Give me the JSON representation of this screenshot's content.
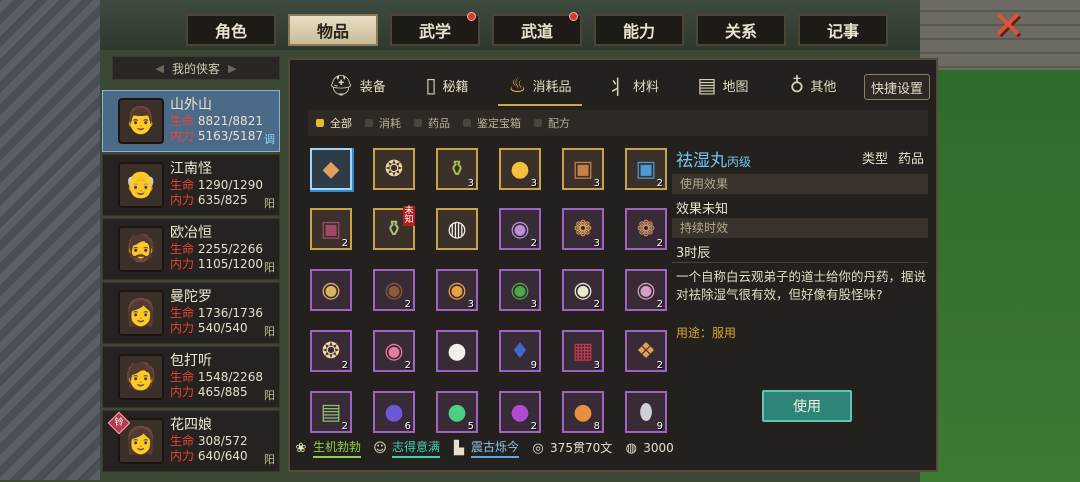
{
  "top_tabs": [
    {
      "label": "角色",
      "active": false,
      "dot": false
    },
    {
      "label": "物品",
      "active": true,
      "dot": false
    },
    {
      "label": "武学",
      "active": false,
      "dot": true
    },
    {
      "label": "武道",
      "active": false,
      "dot": true
    },
    {
      "label": "能力",
      "active": false,
      "dot": false
    },
    {
      "label": "关系",
      "active": false,
      "dot": false
    },
    {
      "label": "记事",
      "active": false,
      "dot": false
    }
  ],
  "close_glyph": "✕",
  "party": {
    "header": "我的侠客",
    "members": [
      {
        "name": "山外山",
        "hp_label": "生命",
        "hp": "8821/8821",
        "mp_label": "内力",
        "mp": "5163/5187",
        "tag": "调",
        "active": true,
        "icon": "👨"
      },
      {
        "name": "江南怪",
        "hp_label": "生命",
        "hp": "1290/1290",
        "mp_label": "内力",
        "mp": "635/825",
        "tag": "阳",
        "active": false,
        "icon": "👴"
      },
      {
        "name": "欧冶恒",
        "hp_label": "生命",
        "hp": "2255/2266",
        "mp_label": "内力",
        "mp": "1105/1200",
        "tag": "阳",
        "active": false,
        "icon": "🧔"
      },
      {
        "name": "曼陀罗",
        "hp_label": "生命",
        "hp": "1736/1736",
        "mp_label": "内力",
        "mp": "540/540",
        "tag": "阳",
        "active": false,
        "icon": "👩"
      },
      {
        "name": "包打听",
        "hp_label": "生命",
        "hp": "1548/2268",
        "mp_label": "内力",
        "mp": "465/885",
        "tag": "阳",
        "active": false,
        "icon": "🧑"
      },
      {
        "name": "花四娘",
        "hp_label": "生命",
        "hp": "308/572",
        "mp_label": "内力",
        "mp": "640/640",
        "tag": "阳",
        "active": false,
        "icon": "👩",
        "badge": "铃"
      }
    ]
  },
  "categories": [
    {
      "label": "装备",
      "icon": "⛑",
      "active": false
    },
    {
      "label": "秘籍",
      "icon": "▯",
      "active": false
    },
    {
      "label": "消耗品",
      "icon": "♨",
      "active": true
    },
    {
      "label": "材料",
      "icon": "⺦",
      "active": false
    },
    {
      "label": "地图",
      "icon": "▤",
      "active": false
    },
    {
      "label": "其他",
      "icon": "♁",
      "active": false
    }
  ],
  "quick_settings": "快捷设置",
  "filters": [
    {
      "label": "全部",
      "active": true
    },
    {
      "label": "消耗",
      "active": false
    },
    {
      "label": "药品",
      "active": false
    },
    {
      "label": "鉴定宝箱",
      "active": false
    },
    {
      "label": "配方",
      "active": false
    }
  ],
  "items": [
    {
      "glyph": "◆",
      "color": "#e0a060",
      "count": "",
      "rarity": "selected"
    },
    {
      "glyph": "❂",
      "color": "#f0d7a8",
      "count": "",
      "rarity": "gold"
    },
    {
      "glyph": "⚱",
      "color": "#9ec04a",
      "count": "3",
      "rarity": "gold"
    },
    {
      "glyph": "●",
      "color": "#f1c23a",
      "count": "3",
      "rarity": "gold"
    },
    {
      "glyph": "▣",
      "color": "#c8804a",
      "count": "3",
      "rarity": "gold"
    },
    {
      "glyph": "▣",
      "color": "#4a9ad8",
      "count": "2",
      "rarity": "gold"
    },
    {
      "glyph": "▣",
      "color": "#a04a6a",
      "count": "2",
      "rarity": "gold"
    },
    {
      "glyph": "⚱",
      "color": "#a9c07a",
      "count": "",
      "rarity": "gold",
      "newtag": "未知"
    },
    {
      "glyph": "◍",
      "color": "#f0ece0",
      "count": "",
      "rarity": "gold"
    },
    {
      "glyph": "◉",
      "color": "#b98fd6",
      "count": "2",
      "rarity": "purple"
    },
    {
      "glyph": "❁",
      "color": "#f2b45a",
      "count": "3",
      "rarity": "purple"
    },
    {
      "glyph": "❁",
      "color": "#e2a070",
      "count": "2",
      "rarity": "purple"
    },
    {
      "glyph": "◉",
      "color": "#d9b560",
      "count": "",
      "rarity": "purple"
    },
    {
      "glyph": "◉",
      "color": "#8a5a3a",
      "count": "2",
      "rarity": "purple"
    },
    {
      "glyph": "◉",
      "color": "#e8a040",
      "count": "3",
      "rarity": "purple"
    },
    {
      "glyph": "◉",
      "color": "#4aa84a",
      "count": "3",
      "rarity": "purple"
    },
    {
      "glyph": "◉",
      "color": "#e8e8d0",
      "count": "2",
      "rarity": "purple"
    },
    {
      "glyph": "◉",
      "color": "#d4a0c8",
      "count": "2",
      "rarity": "purple"
    },
    {
      "glyph": "❂",
      "color": "#f0d7a8",
      "count": "2",
      "rarity": "purple"
    },
    {
      "glyph": "◉",
      "color": "#e87aa0",
      "count": "2",
      "rarity": "purple"
    },
    {
      "glyph": "●",
      "color": "#f2f0e6",
      "count": "",
      "rarity": "purple"
    },
    {
      "glyph": "♦",
      "color": "#3a6ad0",
      "count": "9",
      "rarity": "purple"
    },
    {
      "glyph": "▦",
      "color": "#c23a4a",
      "count": "3",
      "rarity": "purple"
    },
    {
      "glyph": "❖",
      "color": "#e0a050",
      "count": "2",
      "rarity": "purple"
    },
    {
      "glyph": "▤",
      "color": "#8ac070",
      "count": "2",
      "rarity": "purple"
    },
    {
      "glyph": "●",
      "color": "#6a5ad8",
      "count": "6",
      "rarity": "purple"
    },
    {
      "glyph": "●",
      "color": "#4ad080",
      "count": "5",
      "rarity": "purple"
    },
    {
      "glyph": "●",
      "color": "#b04ad0",
      "count": "2",
      "rarity": "purple"
    },
    {
      "glyph": "●",
      "color": "#e89040",
      "count": "8",
      "rarity": "purple"
    },
    {
      "glyph": "⬮",
      "color": "#d0d0d8",
      "count": "9",
      "rarity": "purple"
    }
  ],
  "detail": {
    "name": "祛湿丸",
    "grade": "丙级",
    "type_label": "类型",
    "type_value": "药品",
    "effect_label": "使用效果",
    "effect_value": "效果未知",
    "duration_label": "持续时效",
    "duration_value": "3时辰",
    "description": "一个自称白云观弟子的道士给你的丹药，据说对祛除湿气很有效，但好像有股怪味?",
    "usage": "用途：服用",
    "use_button": "使用"
  },
  "status": [
    {
      "icon": "❀",
      "label": "生机勃勃",
      "kind": "green"
    },
    {
      "icon": "☺",
      "label": "志得意满",
      "kind": "teal"
    },
    {
      "icon": "▙",
      "label": "震古烁今",
      "kind": "blue"
    },
    {
      "icon": "◎",
      "label": "375贯70文",
      "kind": "plain"
    },
    {
      "icon": "◍",
      "label": "3000",
      "kind": "plain"
    }
  ]
}
